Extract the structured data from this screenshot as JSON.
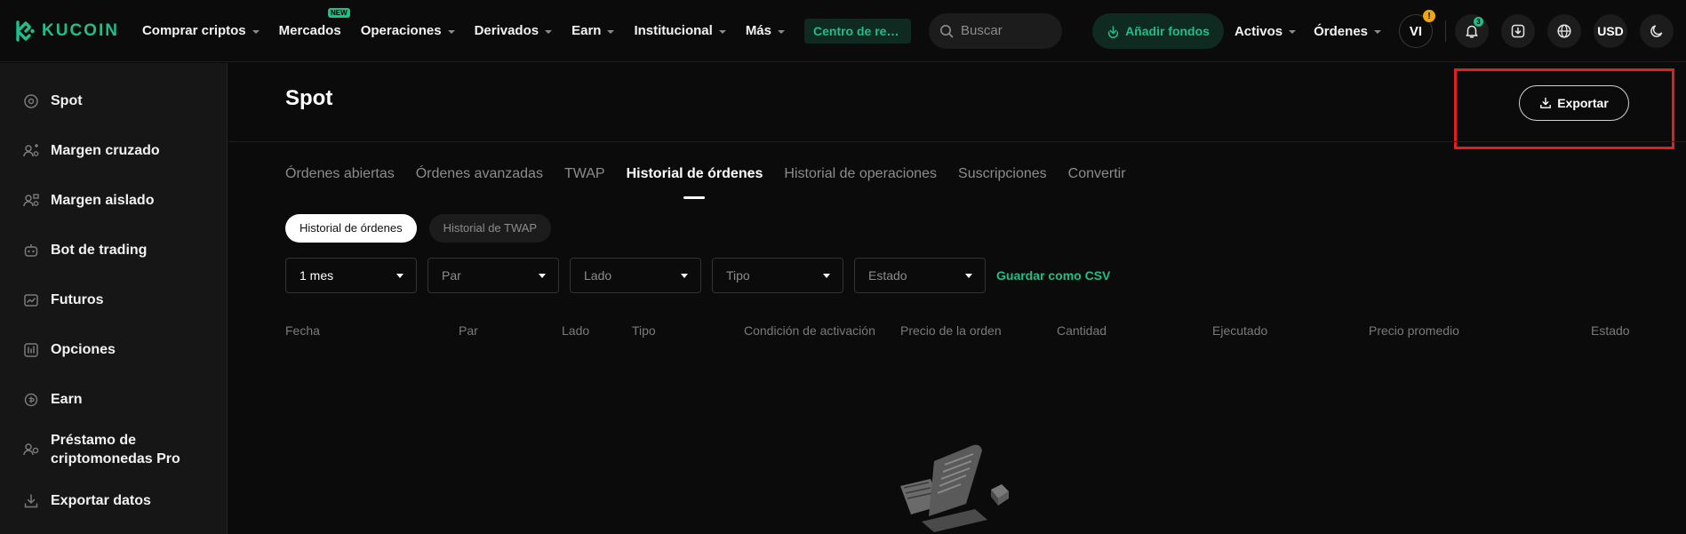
{
  "brand": {
    "name": "KUCOIN",
    "accent": "#1dbf8b"
  },
  "nav": {
    "items": [
      {
        "label": "Comprar criptos",
        "caret": true
      },
      {
        "label": "Mercados",
        "caret": false,
        "badge": "NEW"
      },
      {
        "label": "Operaciones",
        "caret": true
      },
      {
        "label": "Derivados",
        "caret": true
      },
      {
        "label": "Earn",
        "caret": true
      },
      {
        "label": "Institucional",
        "caret": true
      },
      {
        "label": "Más",
        "caret": true
      }
    ],
    "center_button": "Centro de rec...",
    "search_placeholder": "Buscar",
    "add_funds": "Añadir fondos",
    "assets": "Activos",
    "orders": "Órdenes",
    "avatar_initials": "VI",
    "avatar_alert": "!",
    "notification_count": "3",
    "currency": "USD"
  },
  "sidebar": {
    "items": [
      {
        "label": "Spot",
        "icon": "spot-icon"
      },
      {
        "label": "Margen cruzado",
        "icon": "cross-margin-icon"
      },
      {
        "label": "Margen aislado",
        "icon": "isolated-margin-icon"
      },
      {
        "label": "Bot de trading",
        "icon": "robot-icon"
      },
      {
        "label": "Futuros",
        "icon": "futures-icon"
      },
      {
        "label": "Opciones",
        "icon": "options-icon"
      },
      {
        "label": "Earn",
        "icon": "earn-icon"
      },
      {
        "label": "Préstamo de criptomonedas Pro",
        "icon": "loan-icon"
      },
      {
        "label": "Exportar datos",
        "icon": "export-data-icon"
      }
    ]
  },
  "main": {
    "title": "Spot",
    "export_label": "Exportar",
    "tabs": [
      {
        "label": "Órdenes abiertas",
        "active": false
      },
      {
        "label": "Órdenes avanzadas",
        "active": false
      },
      {
        "label": "TWAP",
        "active": false
      },
      {
        "label": "Historial de órdenes",
        "active": true
      },
      {
        "label": "Historial de operaciones",
        "active": false
      },
      {
        "label": "Suscripciones",
        "active": false
      },
      {
        "label": "Convertir",
        "active": false
      }
    ],
    "subtabs": [
      {
        "label": "Historial de órdenes",
        "active": true
      },
      {
        "label": "Historial de TWAP",
        "active": false
      }
    ],
    "filters": [
      {
        "value": "1 mes",
        "selected": true
      },
      {
        "value": "Par",
        "selected": false
      },
      {
        "value": "Lado",
        "selected": false
      },
      {
        "value": "Tipo",
        "selected": false
      },
      {
        "value": "Estado",
        "selected": false
      }
    ],
    "save_csv": "Guardar como CSV",
    "columns": [
      "Fecha",
      "Par",
      "Lado",
      "Tipo",
      "Condición de activación",
      "Precio de la orden",
      "Cantidad",
      "Ejecutado",
      "Precio promedio",
      "Estado"
    ]
  }
}
